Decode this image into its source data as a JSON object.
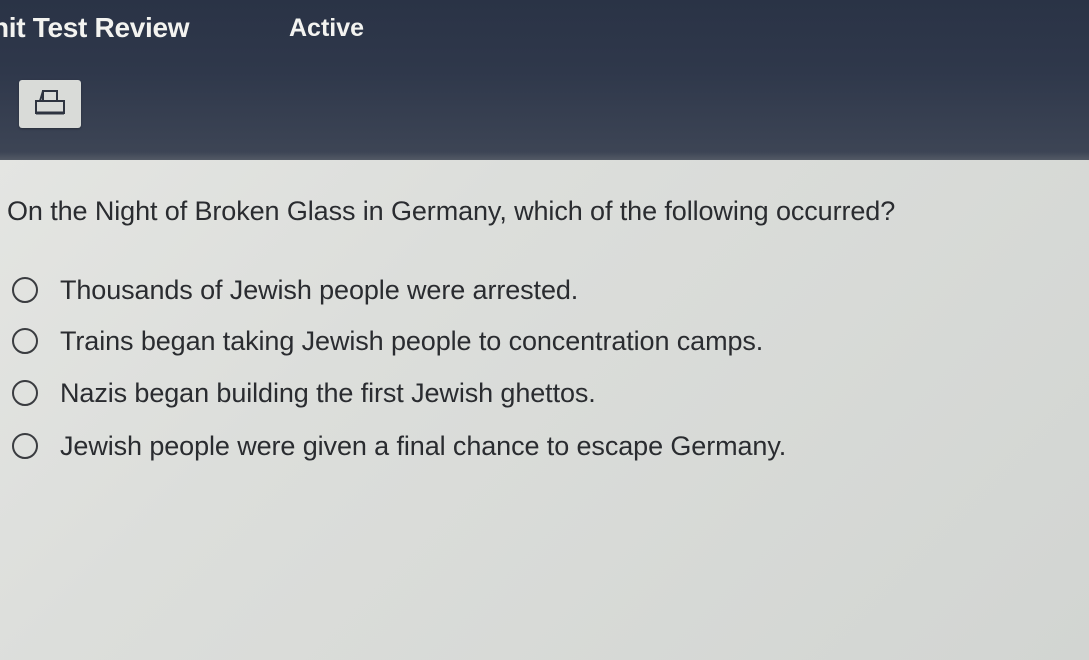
{
  "header": {
    "title": "nit Test Review",
    "status": "Active",
    "print_icon": "printer-icon"
  },
  "question": {
    "text": "On the Night of Broken Glass in Germany, which of the following occurred?",
    "options": [
      {
        "label": "Thousands of Jewish people were arrested.",
        "selected": false
      },
      {
        "label": "Trains began taking Jewish people to concentration camps.",
        "selected": false
      },
      {
        "label": "Nazis began building the first Jewish ghettos.",
        "selected": false
      },
      {
        "label": "Jewish people were given a final chance to escape Germany.",
        "selected": false
      }
    ]
  },
  "colors": {
    "header_bg": "#2f384b",
    "header_text": "#f3f3f0",
    "body_bg": "#dfe0dd",
    "text": "#2a2c30"
  }
}
